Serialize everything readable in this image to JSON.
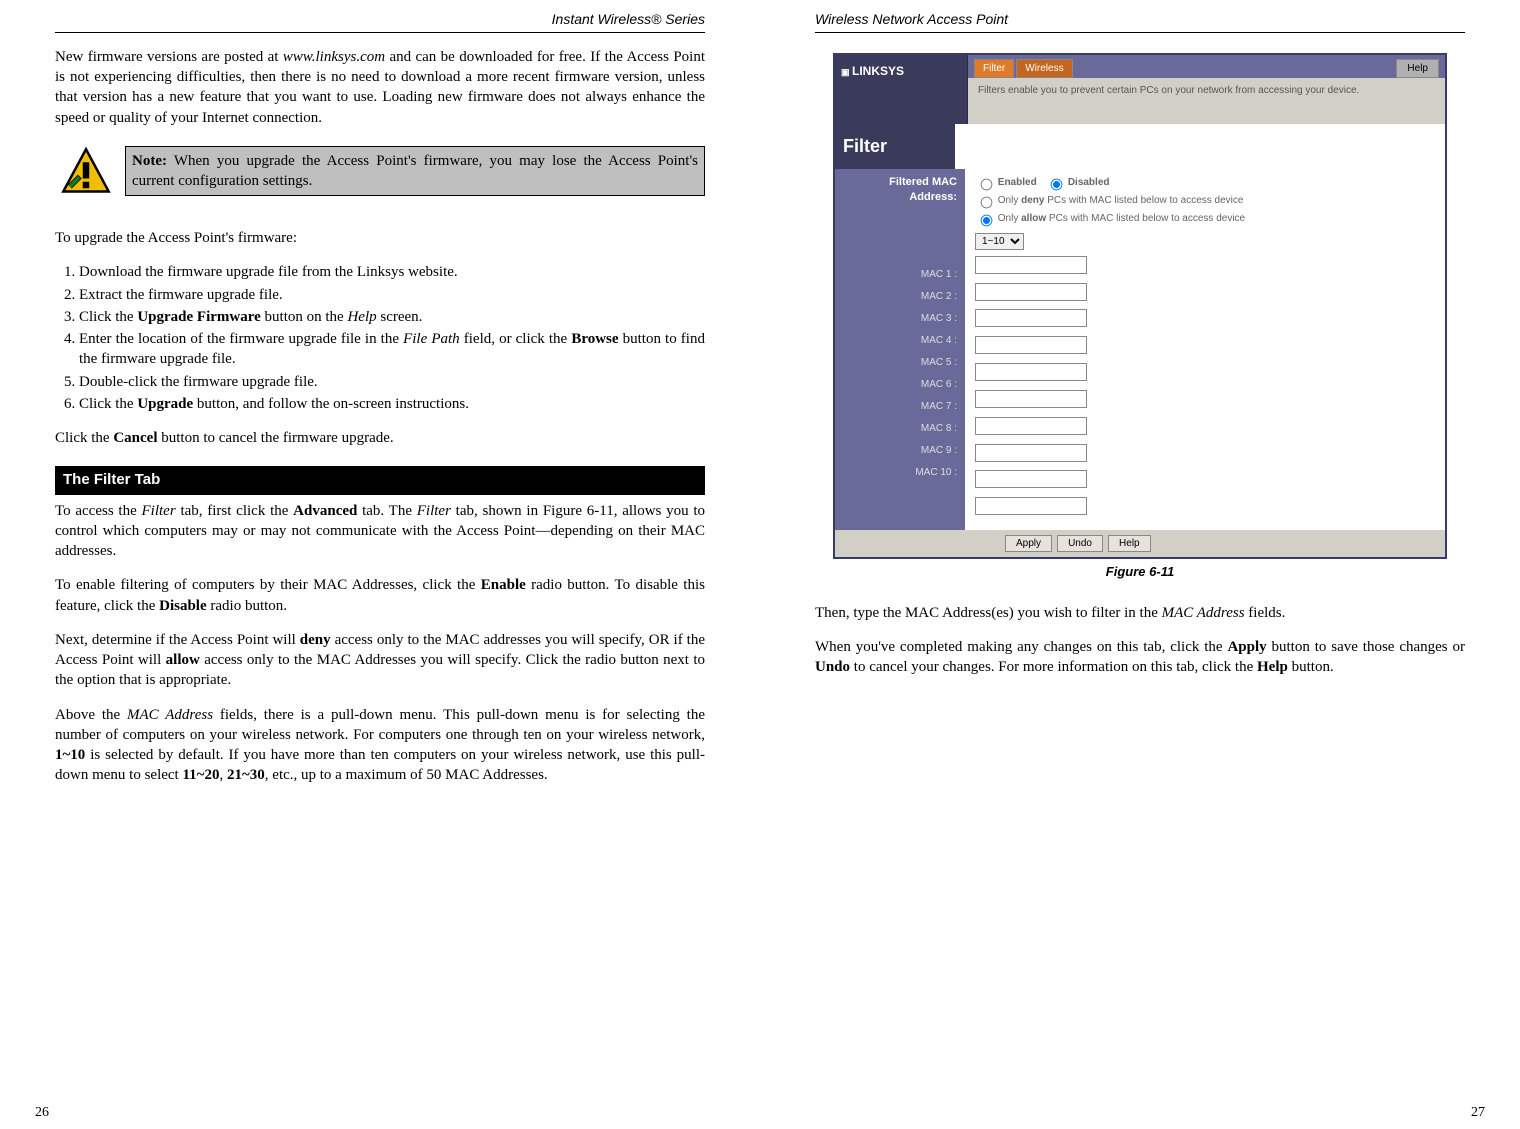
{
  "left_page": {
    "running_head": "Instant Wireless® Series",
    "page_number": "26",
    "intro_html": "New firmware versions are posted at <i>www.linksys.com</i> and can be downloaded for free. If the Access Point is not experiencing difficulties, then there is no need to download a more recent firmware version, unless that version has a new feature that you want to use. Loading new firmware does not always enhance the speed or quality of your Internet connection.",
    "note_html": "<b>Note:</b> When you upgrade the Access Point's firmware, you may lose the Access Point's current configuration settings.",
    "upgrade_lead": "To upgrade the Access Point's firmware:",
    "steps_html": [
      "Download the firmware upgrade file from the Linksys website.",
      "Extract the firmware upgrade file.",
      "Click the <b>Upgrade Firmware</b> button on the <i>Help</i> screen.",
      "Enter the location of the firmware upgrade file in the <i>File Path</i> field, or click the <b>Browse</b> button to find the firmware upgrade file.",
      "Double-click the firmware upgrade file.",
      "Click the <b>Upgrade</b> button, and follow the on-screen instructions."
    ],
    "cancel_html": "Click the <b>Cancel</b> button to cancel the firmware upgrade.",
    "section_title": "The Filter Tab",
    "filter_p1_html": "To access the <i>Filter</i> tab, first click the <b>Advanced</b> tab. The <i>Filter</i> tab, shown in Figure 6-11, allows you to control which computers may or may not communicate with the Access Point—depending on their MAC addresses.",
    "filter_p2_html": "To enable filtering of computers by their MAC Addresses, click the <b>Enable</b> radio button. To disable this feature, click the <b>Disable</b> radio button.",
    "filter_p3_html": "Next, determine if the Access Point will <b>deny</b> access only to the MAC addresses you will specify, OR if the Access Point will <b>allow</b> access only to the MAC Addresses you will specify. Click the radio button next to the option that is appropriate.",
    "filter_p4_html": "Above the <i>MAC Address</i> fields, there is a pull-down menu. This pull-down menu is for selecting the number of computers on your wireless network. For computers one through ten on your wireless network, <b>1~10</b> is selected by default. If you have more than ten computers on your wireless network, use this pull-down menu to select <b>11~20</b>, <b>21~30</b>, etc., up to a maximum of 50 MAC Addresses."
  },
  "right_page": {
    "running_head": "Wireless Network Access Point",
    "page_number": "27",
    "figure_caption": "Figure 6-11",
    "after_fig_p1_html": "Then, type the MAC Address(es) you wish to filter in the <i>MAC Address</i> fields.",
    "after_fig_p2_html": "When you've completed making any changes on this tab, click the <b>Apply</b> button to save those changes or <b>Undo</b> to cancel your changes. For more information on this tab, click the <b>Help</b> button."
  },
  "router_ui": {
    "brand": "LINKSYS",
    "tabs": [
      "Filter",
      "Wireless"
    ],
    "tab_help": "Help",
    "desc": "Filters enable you to prevent certain PCs on your network from accessing your device.",
    "side_title": "Filter",
    "left_header": "Filtered MAC Address:",
    "opt_enabled": "Enabled",
    "opt_disabled": "Disabled",
    "opt_deny_html": "Only <b>deny</b> PCs with MAC listed below to access device",
    "opt_allow_html": "Only <b>allow</b> PCs with MAC listed below to access device",
    "range_selected": "1~10",
    "mac_labels": [
      "MAC 1 :",
      "MAC 2 :",
      "MAC 3 :",
      "MAC 4 :",
      "MAC 5 :",
      "MAC 6 :",
      "MAC 7 :",
      "MAC 8 :",
      "MAC 9 :",
      "MAC 10 :"
    ],
    "footer_buttons": [
      "Apply",
      "Undo",
      "Help"
    ]
  }
}
